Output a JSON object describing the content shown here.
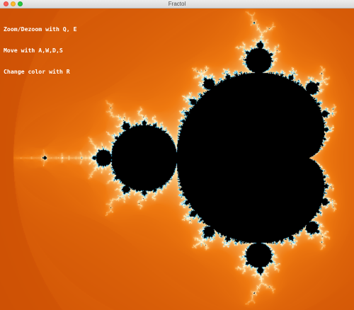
{
  "window": {
    "title": "Fractol"
  },
  "instructions": [
    "Zoom/Dezoom with Q, E",
    "Move with A,W,D,S",
    "Change color with R"
  ],
  "colors": {
    "outer": "#c04000",
    "mid": "#f07a10",
    "halo": "#ffe9b0",
    "filament": "#35b8e8",
    "set": "#000000"
  }
}
